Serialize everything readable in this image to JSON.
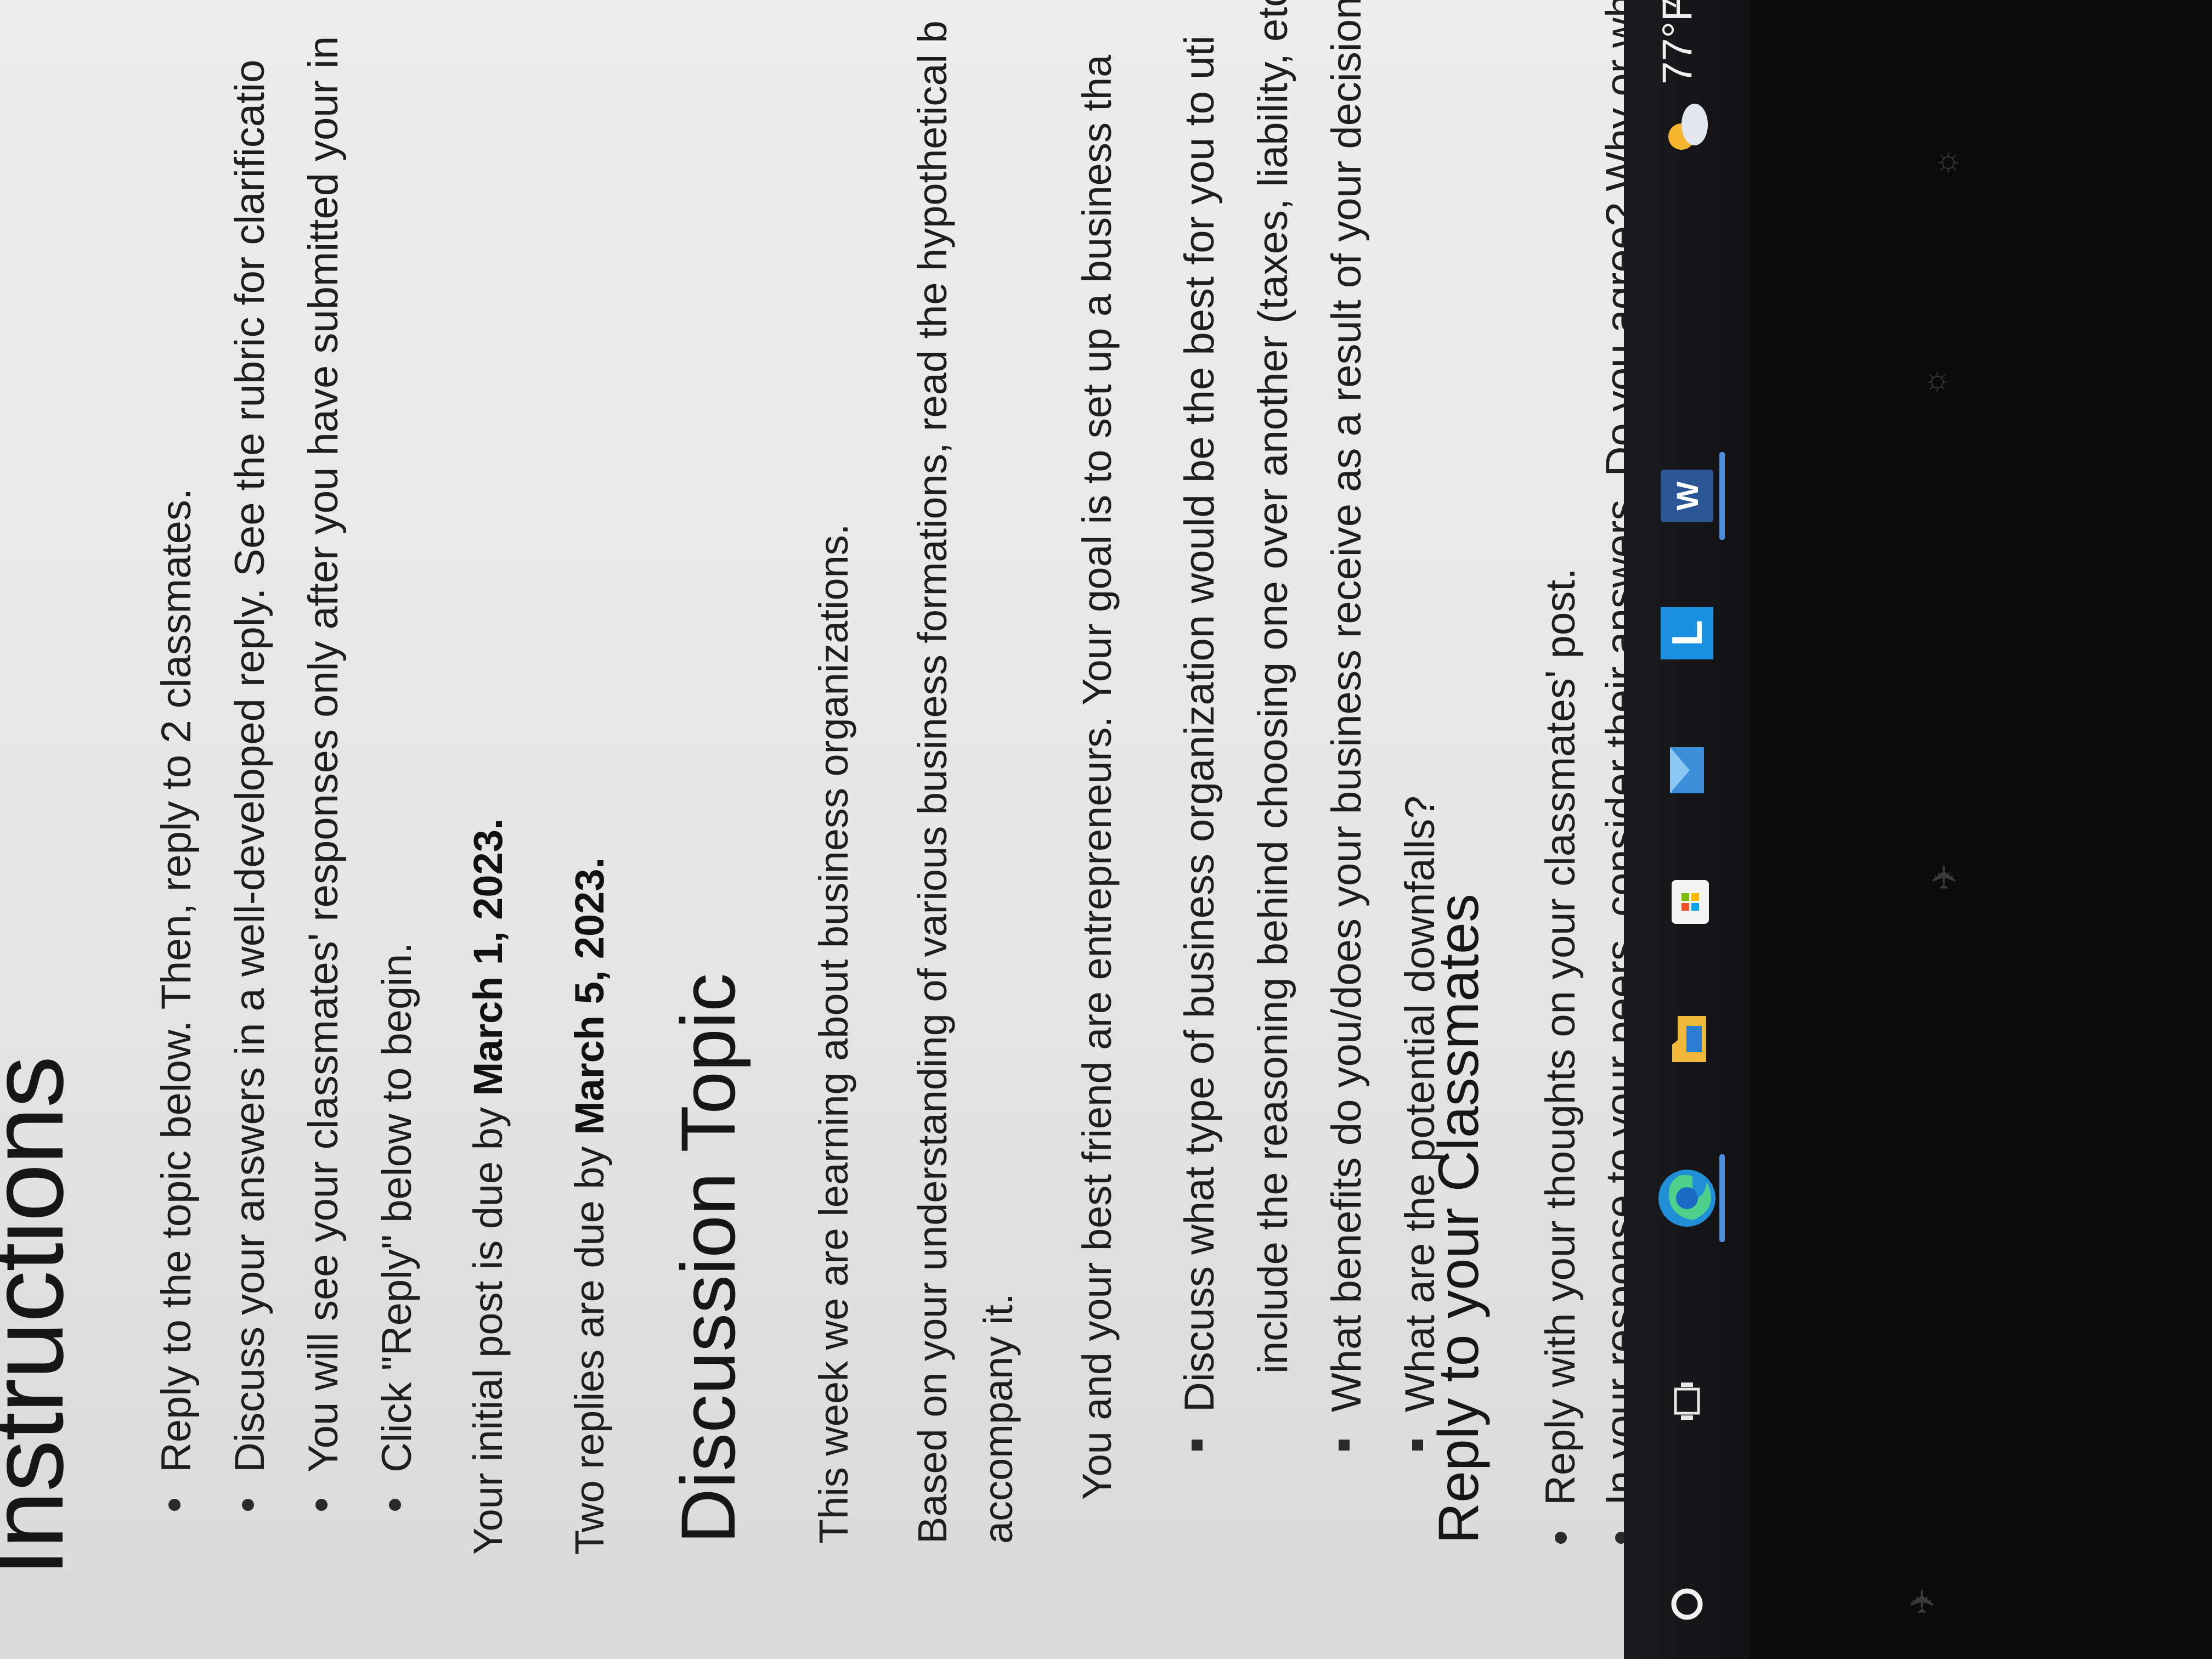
{
  "instructions": {
    "title": "Instructions",
    "bullets": [
      "Reply to the topic below. Then, reply to 2 classmates.",
      "Discuss your answers in a well-developed reply. See the rubric for clarificatio",
      "You will see your classmates' responses only after you have submitted your in",
      "Click \"Reply\" below to begin."
    ],
    "due_initial_prefix": "Your initial post is due by ",
    "due_initial_date": "March 1, 2023.",
    "due_replies_prefix": "Two replies are due by ",
    "due_replies_date": "March 5, 2023."
  },
  "discussion": {
    "title": "Discussion Topic",
    "intro": "This week we are learning about business organizations.",
    "based_line1": "Based on your understanding of various business formations, read the hypothetical b",
    "based_line2": "accompany it.",
    "scenario": "You and your best friend are entrepreneurs. Your goal is to set up a business tha",
    "questions": [
      "Discuss what type of business organization would be the best for you to uti",
      "include the reasoning behind choosing one over another (taxes, liability, etc.)",
      "What benefits do you/does your business receive as a result of your decision",
      "What are the potential downfalls?"
    ]
  },
  "reply": {
    "title": "Reply to your Classmates",
    "bullets": [
      "Reply with your thoughts on your classmates' post.",
      "In your response to your peers, consider their answers. Do you agree?  Why or why no"
    ]
  },
  "taskbar": {
    "icons": [
      "search-icon",
      "task-view-icon",
      "edge-icon",
      "file-explorer-icon",
      "microsoft-store-icon",
      "mail-icon",
      "lockdown-browser-icon",
      "word-icon"
    ],
    "word_label": "W",
    "l_label": "L",
    "weather": {
      "temp": "77°F",
      "icon": "partly-cloudy-icon"
    },
    "tray": "^"
  },
  "colors": {
    "page_bg": "#e6e6e6",
    "text": "#1e1e1e",
    "taskbar": "#16161a",
    "accent": "#4c8fdc"
  }
}
